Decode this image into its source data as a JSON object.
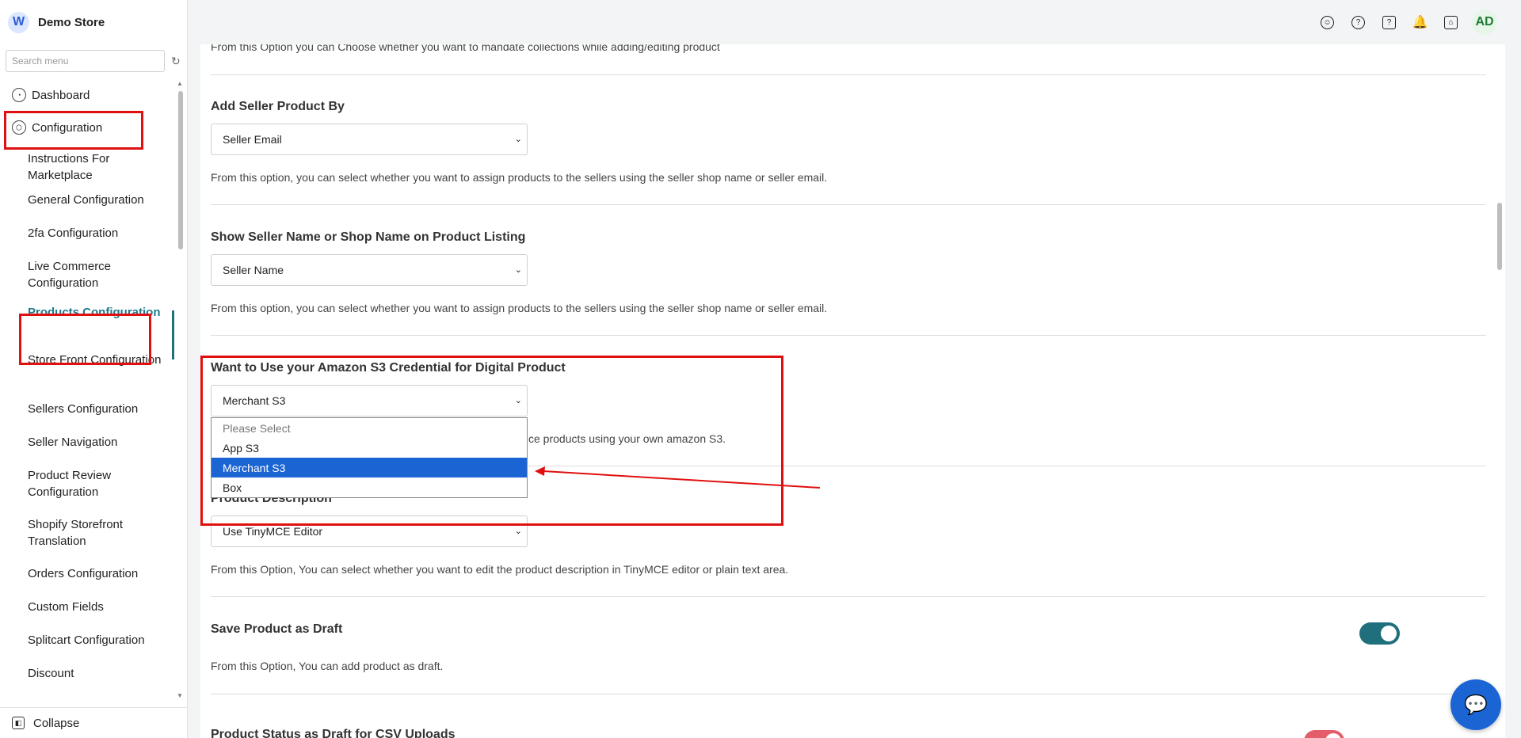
{
  "brand": {
    "name": "Demo Store",
    "logo_letter": "W"
  },
  "search": {
    "placeholder": "Search menu"
  },
  "sidebar": {
    "top_items": [
      {
        "label": "Dashboard",
        "icon": "dashboard-icon"
      },
      {
        "label": "Configuration",
        "icon": "configuration-icon"
      }
    ],
    "sub_items": [
      {
        "label": "Instructions For Marketplace"
      },
      {
        "label": "General Configuration"
      },
      {
        "label": "2fa Configuration"
      },
      {
        "label": "Live Commerce Configuration"
      },
      {
        "label": "Products Configuration",
        "active": true
      },
      {
        "label": "Store Front Configuration"
      },
      {
        "label": "Sellers Configuration"
      },
      {
        "label": "Seller Navigation"
      },
      {
        "label": "Product Review Configuration"
      },
      {
        "label": "Shopify Storefront Translation"
      },
      {
        "label": "Orders Configuration"
      },
      {
        "label": "Custom Fields"
      },
      {
        "label": "Splitcart Configuration"
      },
      {
        "label": "Discount"
      }
    ],
    "collapse_label": "Collapse"
  },
  "topbar": {
    "icons": [
      "account-icon",
      "help-icon",
      "support-icon",
      "bell-icon",
      "store-icon"
    ],
    "avatar": "AD"
  },
  "main": {
    "top_desc": "From this Option you can Choose whether you want to mandate collections while adding/editing product",
    "sections": [
      {
        "title": "Add Seller Product By",
        "value": "Seller Email",
        "desc": "From this option, you can select whether you want to assign products to the sellers using the seller shop name or seller email."
      },
      {
        "title": "Show Seller Name or Shop Name on Product Listing",
        "value": "Seller Name",
        "desc": "From this option, you can select whether you want to assign products to the sellers using the seller shop name or seller email."
      },
      {
        "title": "Want to Use your Amazon S3 Credential for Digital Product",
        "value": "Merchant S3",
        "desc_visible": "ce products using your own amazon S3."
      },
      {
        "title": "Product Description",
        "value": "Use TinyMCE Editor",
        "desc": "From this Option, You can select whether you want to edit the product description in TinyMCE editor or plain text area."
      },
      {
        "title": "Save Product as Draft",
        "desc": "From this Option, You can add product as draft.",
        "toggle_on": true
      },
      {
        "title": "Product Status as Draft for CSV Uploads"
      }
    ],
    "dropdown_options": [
      "Please Select",
      "App S3",
      "Merchant S3",
      "Box"
    ],
    "dropdown_selected": "Merchant S3"
  },
  "colors": {
    "accent": "#1f6f7c",
    "selection": "#1a64d4",
    "annotation": "#e01010"
  }
}
